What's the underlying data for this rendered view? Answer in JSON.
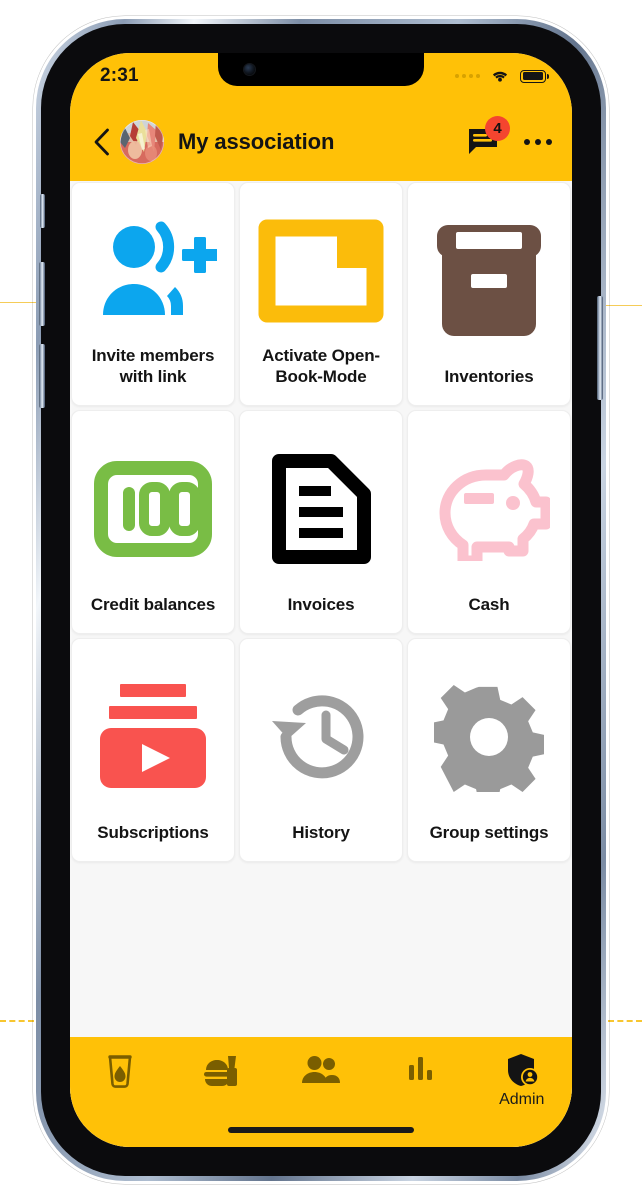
{
  "status_bar": {
    "time": "2:31",
    "signal_icon": "signal-dots-icon",
    "wifi_icon": "wifi-icon",
    "battery_icon": "battery-full-icon"
  },
  "app_bar": {
    "back_icon": "chevron-left-icon",
    "avatar": "group-photo-avatar",
    "title": "My association",
    "chat_icon": "chat-bubble-icon",
    "badge_count": "4",
    "overflow_icon": "more-horizontal-icon"
  },
  "theme": {
    "accent": "#FFC107",
    "badge": "#F4452F",
    "page_bg": "#F7F7F7",
    "tile_bg": "#FFFFFF",
    "text": "#141414"
  },
  "grid": {
    "tiles": [
      {
        "label": "Invite members with link",
        "icon": "person-add-icon",
        "color": "#0CA6EE"
      },
      {
        "label": "Activate Open-Book-Mode",
        "icon": "folder-icon",
        "color": "#FBBC0B"
      },
      {
        "label": "Inventories",
        "icon": "archive-box-icon",
        "color": "#6C5044"
      },
      {
        "label": "Credit balances",
        "icon": "banknote-100-icon",
        "color": "#79BD45"
      },
      {
        "label": "Invoices",
        "icon": "document-lines-icon",
        "color": "#000000"
      },
      {
        "label": "Cash",
        "icon": "piggy-bank-icon",
        "color": "#FBC2CE"
      },
      {
        "label": "Subscriptions",
        "icon": "subscriptions-play-icon",
        "color": "#F9534F"
      },
      {
        "label": "History",
        "icon": "history-clock-icon",
        "color": "#9E9E9E"
      },
      {
        "label": "Group settings",
        "icon": "gear-icon",
        "color": "#9A9A9A"
      }
    ]
  },
  "tab_bar": {
    "items": [
      {
        "label": "",
        "icon": "drink-glass-icon",
        "active": false
      },
      {
        "label": "",
        "icon": "food-meal-icon",
        "active": false
      },
      {
        "label": "",
        "icon": "people-icon",
        "active": false
      },
      {
        "label": "",
        "icon": "bar-chart-icon",
        "active": false
      },
      {
        "label": "Admin",
        "icon": "shield-person-icon",
        "active": true
      }
    ]
  }
}
